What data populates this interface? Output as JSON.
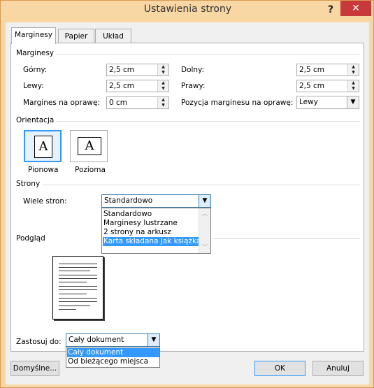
{
  "window": {
    "title": "Ustawienia strony",
    "help": "?",
    "close": "✕"
  },
  "tabs": [
    {
      "label": "Marginesy"
    },
    {
      "label": "Papier"
    },
    {
      "label": "Układ"
    }
  ],
  "margins": {
    "group_label": "Marginesy",
    "top": {
      "label": "Górny:",
      "value": "2,5 cm"
    },
    "bottom": {
      "label": "Dolny:",
      "value": "2,5 cm"
    },
    "left": {
      "label": "Lewy:",
      "value": "2,5 cm"
    },
    "right": {
      "label": "Prawy:",
      "value": "2,5 cm"
    },
    "gutter": {
      "label": "Margines na oprawę:",
      "value": "0 cm"
    },
    "gutter_pos": {
      "label": "Pozycja marginesu na oprawę:",
      "value": "Lewy"
    }
  },
  "orientation": {
    "group_label": "Orientacja",
    "portrait": {
      "label": "Pionowa",
      "glyph": "A"
    },
    "landscape": {
      "label": "Pozioma",
      "glyph": "A"
    }
  },
  "pages": {
    "group_label": "Strony",
    "multiple_label": "Wiele stron:",
    "selected": "Standardowo",
    "options": [
      "Standardowo",
      "Marginesy lustrzane",
      "2 strony na arkusz",
      "Karta składana jak książka"
    ],
    "highlighted_index": 3
  },
  "preview": {
    "group_label": "Podgląd"
  },
  "apply": {
    "label": "Zastosuj do:",
    "selected": "Cały dokument",
    "options": [
      "Cały dokument",
      "Od bieżącego miejsca"
    ],
    "highlighted_index": 0
  },
  "buttons": {
    "default": "Domyślne...",
    "ok": "OK",
    "cancel": "Anuluj"
  },
  "colors": {
    "titlebar": "#f8d7a4",
    "close": "#c7393b",
    "selection": "#3399ff"
  }
}
